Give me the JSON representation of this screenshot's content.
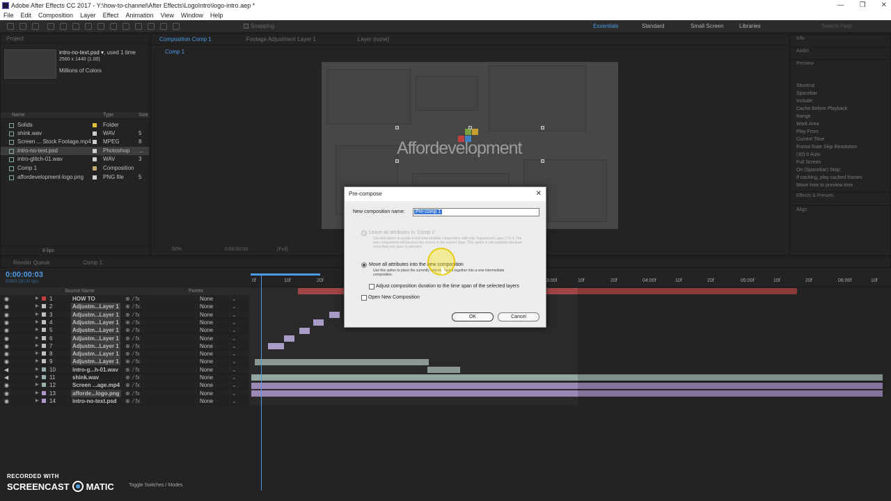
{
  "app": {
    "title": "Adobe After Effects CC 2017 - Y:\\how-to-channel\\After Effects\\LogoIntro\\logo-intro.aep *",
    "window_buttons": [
      "—",
      "❐",
      "✕"
    ]
  },
  "menu": [
    "File",
    "Edit",
    "Composition",
    "Layer",
    "Effect",
    "Animation",
    "View",
    "Window",
    "Help"
  ],
  "workspaces": {
    "items": [
      "Essentials",
      "Standard",
      "Small Screen",
      "Libraries"
    ],
    "active": "Essentials",
    "search_placeholder": "Search Help"
  },
  "toolbar": {
    "snapping": "Snapping"
  },
  "project": {
    "header": "Project",
    "selected_name": "intro-no-text.psd ▾",
    "used": ", used 1 time",
    "dimensions": "2560 x 1440 (1.00)",
    "colors": "Millions of Colors",
    "columns": {
      "name": "Name",
      "type": "Type",
      "size": "Size"
    },
    "items": [
      {
        "name": "Solids",
        "type": "Folder",
        "size": "",
        "color": "#e0c23a"
      },
      {
        "name": "shink.wav",
        "type": "WAV",
        "size": "5",
        "color": "#cfcfcf"
      },
      {
        "name": "Screen ... Stock Footage.mp4",
        "type": "MPEG",
        "size": "8",
        "color": "#cfcfcf"
      },
      {
        "name": "intro-no-text.psd",
        "type": "Photoshop",
        "size": "...",
        "color": "#cfcfcf"
      },
      {
        "name": "intro-glitch-01.wav",
        "type": "WAV",
        "size": "3",
        "color": "#cfcfcf"
      },
      {
        "name": "Comp 1",
        "type": "Composition",
        "size": "",
        "color": "#c8a878"
      },
      {
        "name": "affordevelopment-logo.png",
        "type": "PNG file",
        "size": "5",
        "color": "#cfcfcf"
      }
    ],
    "bpc": "8 bpc"
  },
  "composition": {
    "tabs": [
      "Composition Comp 1",
      "Footage Adjustment Layer 1",
      "Layer (none)"
    ],
    "subtab": "Comp 1",
    "logo_text": "Affordevelopment",
    "zoom": "50%",
    "timecode": "0:00:00:03",
    "quality": "(Full)"
  },
  "right_panel": {
    "sections": [
      "Info",
      "Audio",
      "Preview"
    ],
    "preview": {
      "shortcut_label": "Shortcut",
      "shortcut": "Spacebar",
      "include": "Include:",
      "cache": "Cache Before Playback",
      "range": "Range",
      "range_val": "Work Area",
      "play_from": "Play From",
      "play_from_val": "Current Time",
      "frame_rate": "Frame Rate",
      "skip": "Skip",
      "resolution": "Resolution",
      "fps": "(30)",
      "skip_val": "0",
      "res_val": "Auto",
      "fullscreen": "Full Screen",
      "on_stop": "On (Spacebar) Stop:",
      "if_caching": "If caching, play cached frames",
      "move_time": "Move time to preview time"
    },
    "effects": "Effects & Presets",
    "align": "Align"
  },
  "timeline_tabs": [
    "Render Queue",
    "Comp 1"
  ],
  "timeline": {
    "timecode": "0:00:00:03",
    "fps_text": "00003 (30.00 fps)",
    "header": {
      "source": "Source Name",
      "parent": "Parent"
    },
    "ruler": [
      "0f",
      "10f",
      "20f",
      "01:00f",
      "10f",
      "20f",
      "02:00f",
      "10f",
      "20f",
      "03:00f",
      "10f",
      "20f",
      "04:00f",
      "10f",
      "20f",
      "05:00f",
      "10f",
      "20f",
      "06:00f",
      "10f"
    ],
    "layers": [
      {
        "num": "1",
        "name": "HOW TO",
        "type": "T",
        "color": "#c04040",
        "parent": "None",
        "boxed": false,
        "audio": false
      },
      {
        "num": "2",
        "name": "Adjustm...Layer 1",
        "type": "",
        "color": "#c0c0c0",
        "parent": "None",
        "boxed": true,
        "audio": false
      },
      {
        "num": "3",
        "name": "Adjustm...Layer 1",
        "type": "",
        "color": "#c0c0c0",
        "parent": "None",
        "boxed": true,
        "audio": false
      },
      {
        "num": "4",
        "name": "Adjustm...Layer 1",
        "type": "",
        "color": "#c0c0c0",
        "parent": "None",
        "boxed": true,
        "audio": false
      },
      {
        "num": "5",
        "name": "Adjustm...Layer 1",
        "type": "",
        "color": "#c0c0c0",
        "parent": "None",
        "boxed": true,
        "audio": false
      },
      {
        "num": "6",
        "name": "Adjustm...Layer 1",
        "type": "",
        "color": "#c0c0c0",
        "parent": "None",
        "boxed": true,
        "audio": false
      },
      {
        "num": "7",
        "name": "Adjustm...Layer 1",
        "type": "",
        "color": "#c0c0c0",
        "parent": "None",
        "boxed": true,
        "audio": false
      },
      {
        "num": "8",
        "name": "Adjustm...Layer 1",
        "type": "",
        "color": "#c0c0c0",
        "parent": "None",
        "boxed": true,
        "audio": false
      },
      {
        "num": "9",
        "name": "Adjustm...Layer 1",
        "type": "",
        "color": "#c0c0c0",
        "parent": "None",
        "boxed": true,
        "audio": false
      },
      {
        "num": "10",
        "name": "intro-g...h-01.wav",
        "type": "",
        "color": "#9ab0b0",
        "parent": "None",
        "boxed": false,
        "audio": true
      },
      {
        "num": "11",
        "name": "shink.wav",
        "type": "",
        "color": "#9ab0b0",
        "parent": "None",
        "boxed": false,
        "audio": true
      },
      {
        "num": "12",
        "name": "Screen ...age.mp4",
        "type": "",
        "color": "#9ab0b0",
        "parent": "None",
        "boxed": false,
        "audio": false
      },
      {
        "num": "13",
        "name": "afforde...logo.png",
        "type": "",
        "color": "#b098c8",
        "parent": "None",
        "boxed": true,
        "audio": false
      },
      {
        "num": "14",
        "name": "intro-no-text.psd",
        "type": "",
        "color": "#b098c8",
        "parent": "None",
        "boxed": false,
        "audio": false
      }
    ],
    "footer": "Toggle Switches / Modes"
  },
  "dialog": {
    "title": "Pre-compose",
    "close": "✕",
    "name_label": "New composition name:",
    "name_value": "Pre-comp 1",
    "opt1_label": "Leave all attributes in 'Comp 1'",
    "opt1_desc": "Use this option to create a new intermediate composition with only 'Adjustment Layer 1' in it. The new composition will become the source to the current layer. This option is not available because more than one layer is selected.",
    "opt2_label": "Move all attributes into the new composition",
    "opt2_desc": "Use this option to place the currently selected layers together into a new intermediate composition.",
    "adjust_label": "Adjust composition duration to the time span of the selected layers",
    "open_label": "Open New Composition",
    "ok": "OK",
    "cancel": "Cancel"
  },
  "watermark": {
    "line1": "RECORDED WITH",
    "brand_left": "SCREENCAST",
    "brand_right": "MATIC"
  }
}
